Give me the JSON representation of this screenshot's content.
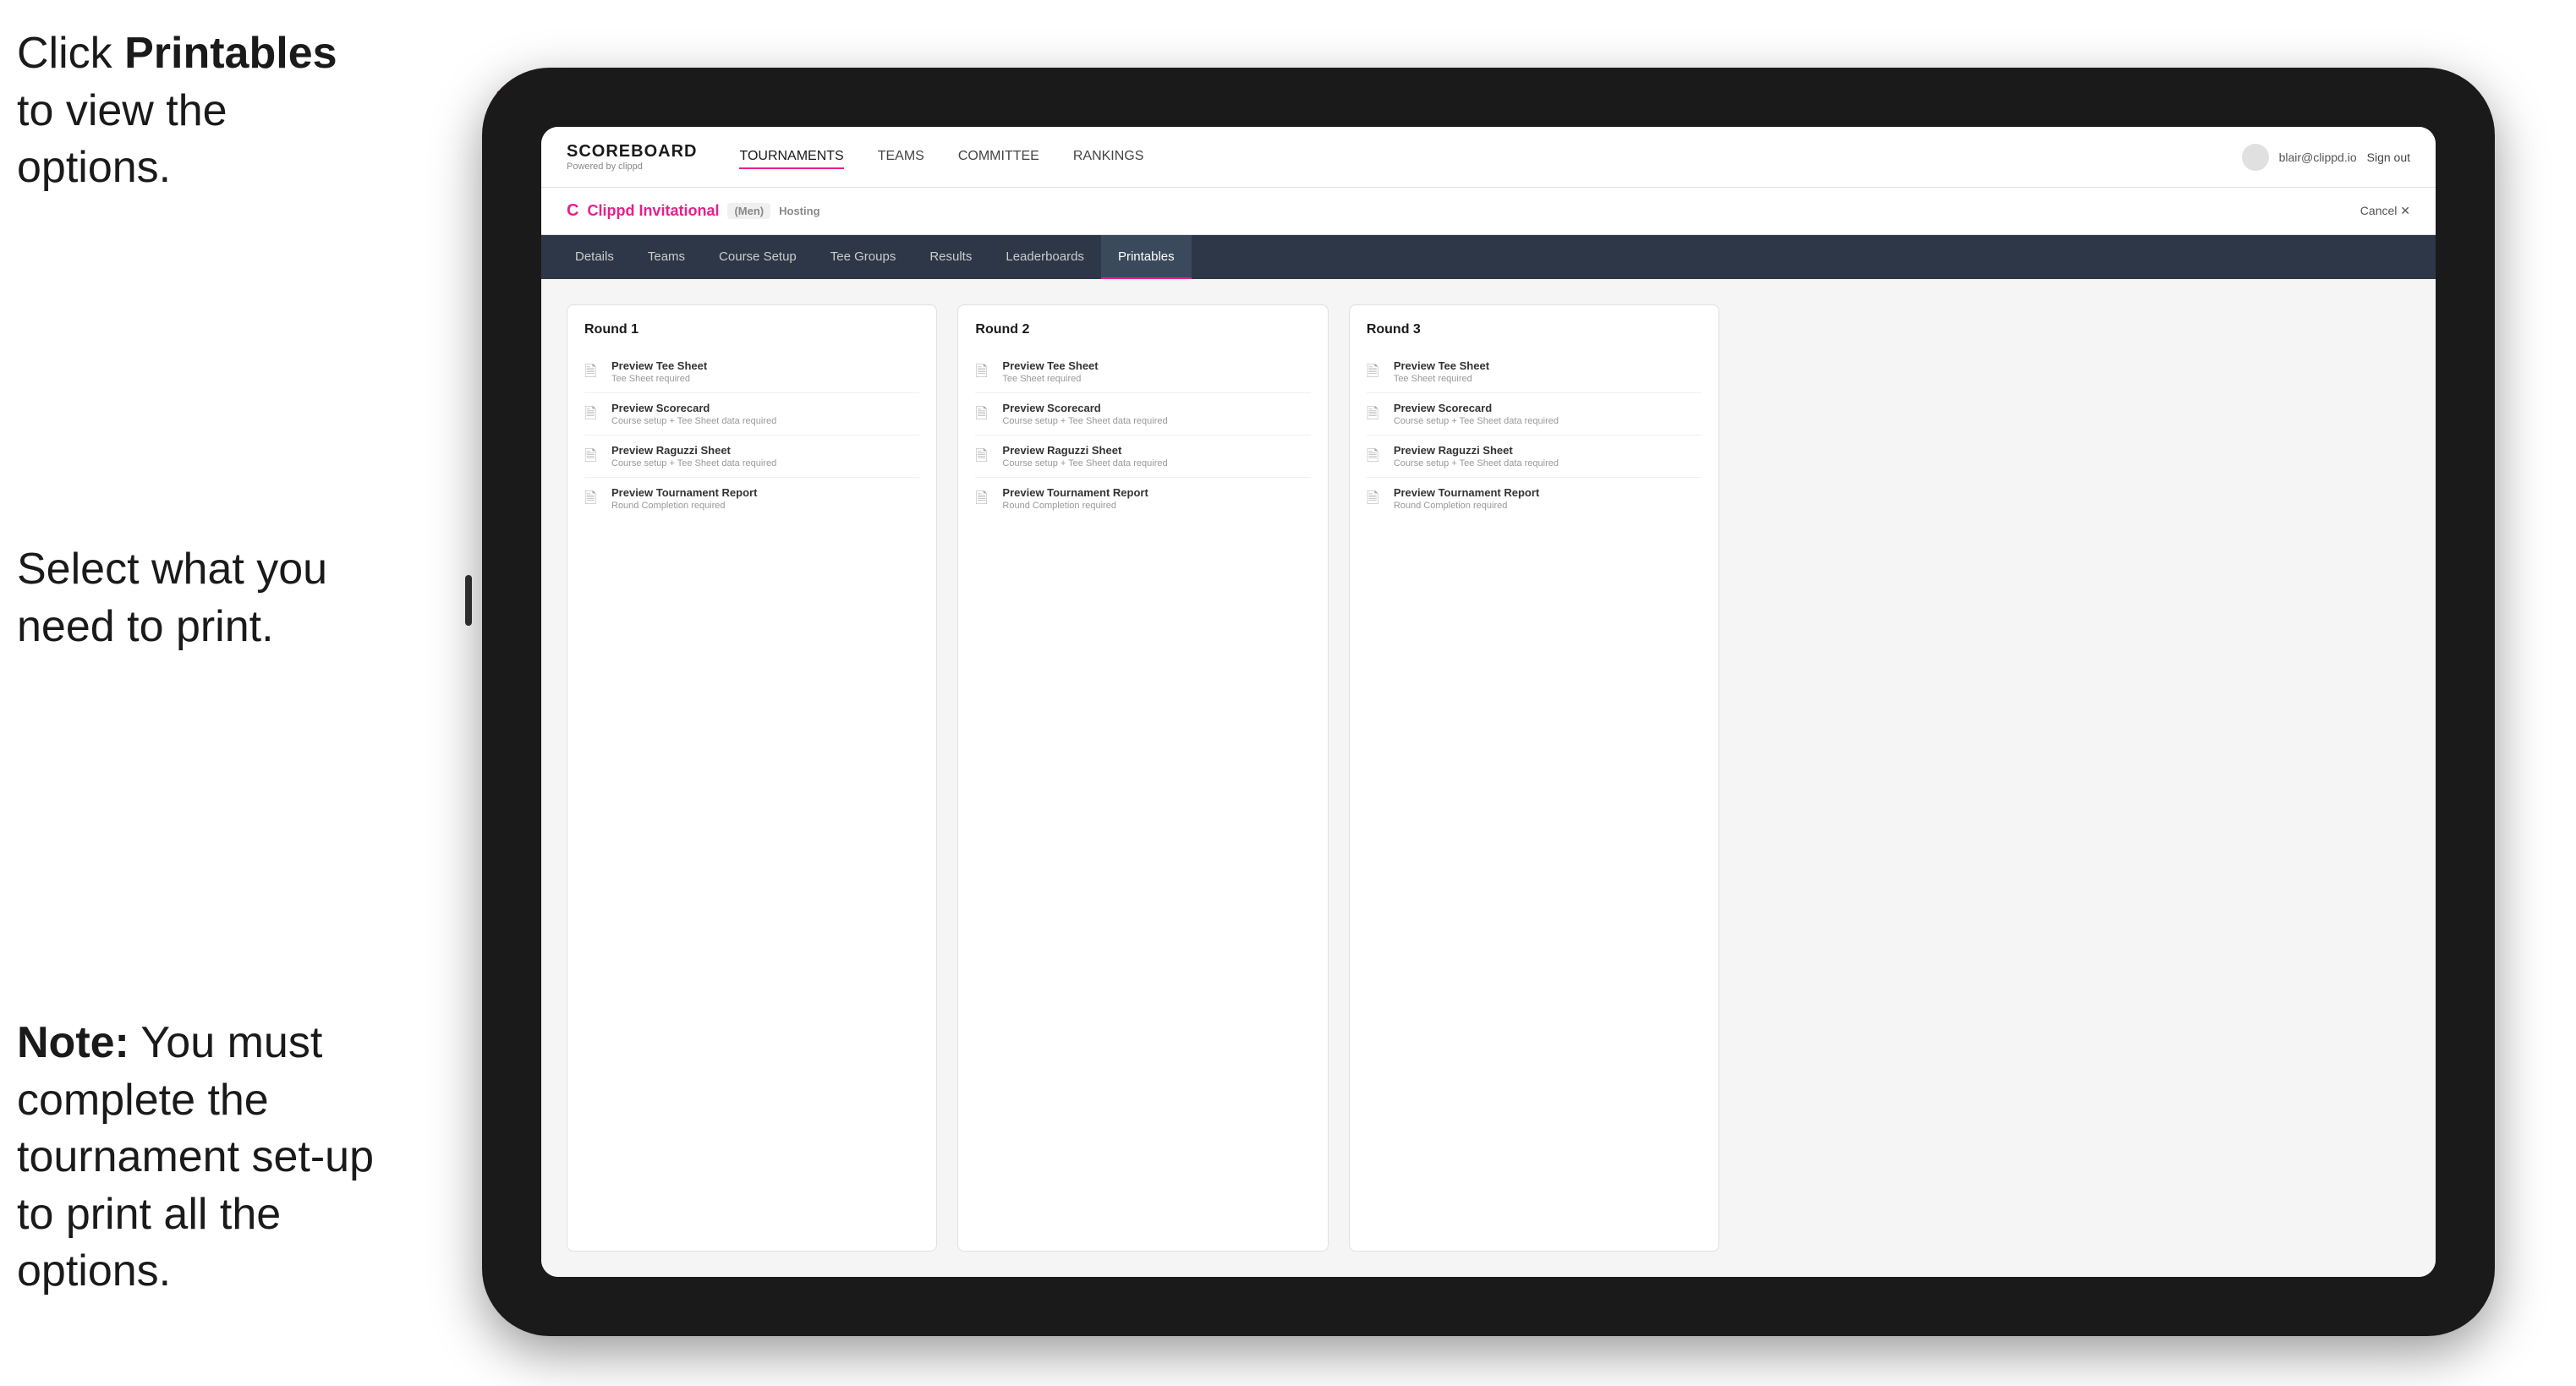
{
  "annotations": {
    "top": {
      "prefix": "Click ",
      "bold": "Printables",
      "suffix": " to view the options."
    },
    "middle": {
      "text": "Select what you need to print."
    },
    "bottom": {
      "bold": "Note:",
      "suffix": " You must complete the tournament set-up to print all the options."
    }
  },
  "topNav": {
    "logoTitle": "SCOREBOARD",
    "logoSubtitle": "Powered by clippd",
    "links": [
      "TOURNAMENTS",
      "TEAMS",
      "COMMITTEE",
      "RANKINGS"
    ],
    "activeLink": "TOURNAMENTS",
    "userEmail": "blair@clippd.io",
    "signOut": "Sign out"
  },
  "subHeader": {
    "icon": "C",
    "tournamentName": "Clippd Invitational",
    "division": "(Men)",
    "status": "Hosting",
    "cancelLabel": "Cancel ✕"
  },
  "tabs": {
    "items": [
      "Details",
      "Teams",
      "Course Setup",
      "Tee Groups",
      "Results",
      "Leaderboards",
      "Printables"
    ],
    "activeTab": "Printables"
  },
  "rounds": [
    {
      "title": "Round 1",
      "items": [
        {
          "title": "Preview Tee Sheet",
          "subtitle": "Tee Sheet required"
        },
        {
          "title": "Preview Scorecard",
          "subtitle": "Course setup + Tee Sheet data required"
        },
        {
          "title": "Preview Raguzzi Sheet",
          "subtitle": "Course setup + Tee Sheet data required"
        },
        {
          "title": "Preview Tournament Report",
          "subtitle": "Round Completion required"
        }
      ]
    },
    {
      "title": "Round 2",
      "items": [
        {
          "title": "Preview Tee Sheet",
          "subtitle": "Tee Sheet required"
        },
        {
          "title": "Preview Scorecard",
          "subtitle": "Course setup + Tee Sheet data required"
        },
        {
          "title": "Preview Raguzzi Sheet",
          "subtitle": "Course setup + Tee Sheet data required"
        },
        {
          "title": "Preview Tournament Report",
          "subtitle": "Round Completion required"
        }
      ]
    },
    {
      "title": "Round 3",
      "items": [
        {
          "title": "Preview Tee Sheet",
          "subtitle": "Tee Sheet required"
        },
        {
          "title": "Preview Scorecard",
          "subtitle": "Course setup + Tee Sheet data required"
        },
        {
          "title": "Preview Raguzzi Sheet",
          "subtitle": "Course setup + Tee Sheet data required"
        },
        {
          "title": "Preview Tournament Report",
          "subtitle": "Round Completion required"
        }
      ]
    }
  ]
}
